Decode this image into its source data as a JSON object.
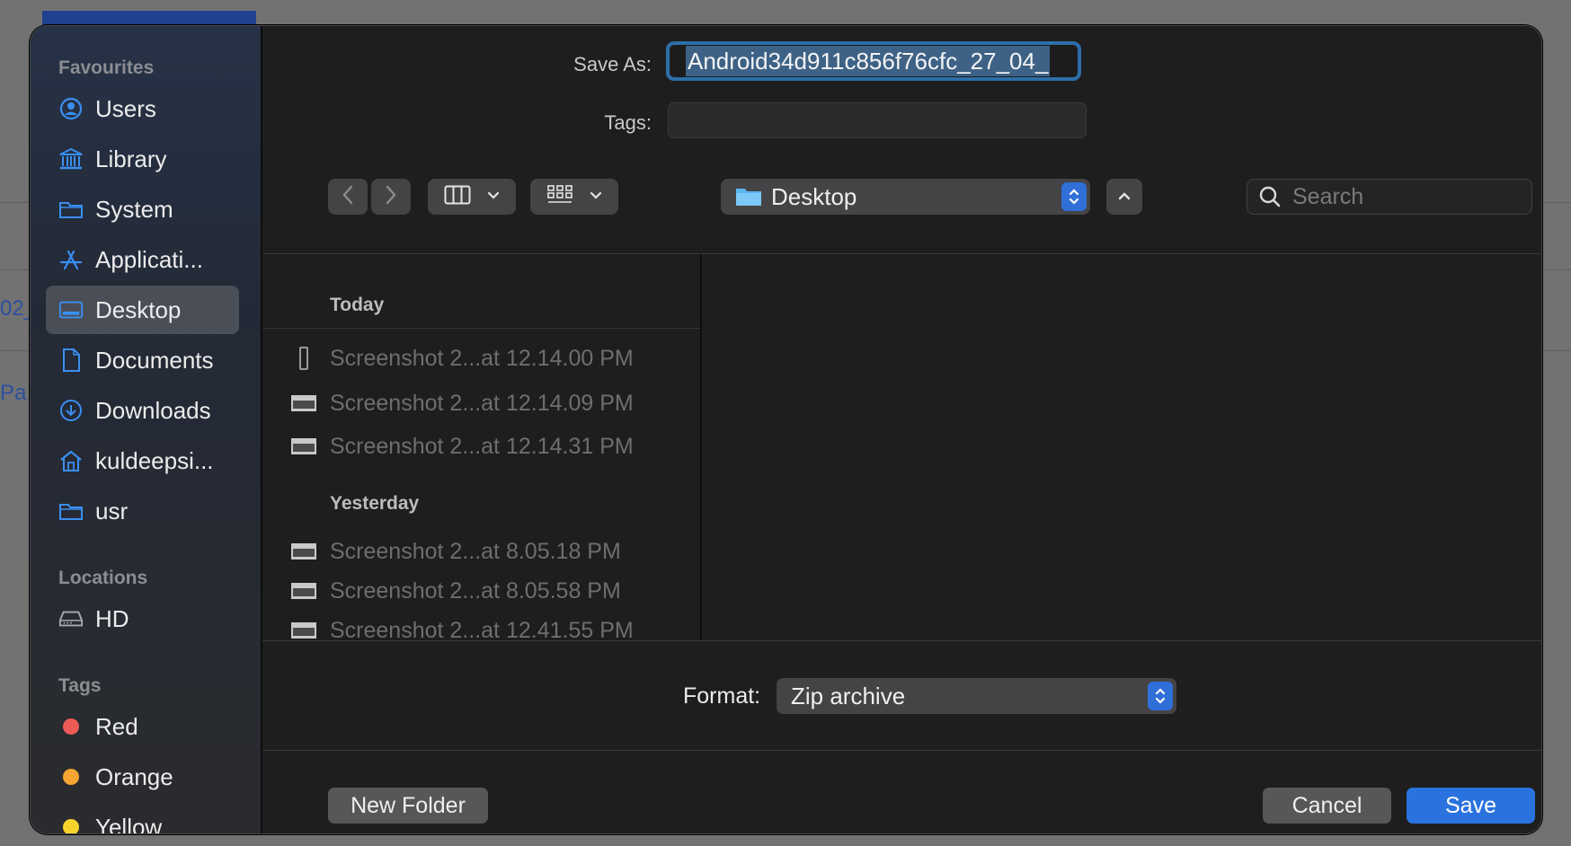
{
  "background": {
    "fragments": [
      "02_",
      "Pa"
    ]
  },
  "sidebar": {
    "favourites_header": "Favourites",
    "favourites": [
      {
        "label": "Users",
        "icon": "user-circle-icon"
      },
      {
        "label": "Library",
        "icon": "library-icon"
      },
      {
        "label": "System",
        "icon": "folder-icon"
      },
      {
        "label": "Applicati...",
        "icon": "applications-icon"
      },
      {
        "label": "Desktop",
        "icon": "desktop-icon",
        "selected": true
      },
      {
        "label": "Documents",
        "icon": "document-icon"
      },
      {
        "label": "Downloads",
        "icon": "download-icon"
      },
      {
        "label": "kuldeepsi...",
        "icon": "home-icon"
      },
      {
        "label": "usr",
        "icon": "folder-icon"
      }
    ],
    "locations_header": "Locations",
    "locations": [
      {
        "label": "HD",
        "icon": "disk-icon"
      }
    ],
    "tags_header": "Tags",
    "tags": [
      {
        "label": "Red",
        "color": "#ec5b56"
      },
      {
        "label": "Orange",
        "color": "#f5a531"
      },
      {
        "label": "Yellow",
        "color": "#f7d42c"
      }
    ]
  },
  "form": {
    "save_as_label": "Save As:",
    "save_as_value": "Android34d911c856f76cfc_27_04_",
    "tags_label": "Tags:",
    "tags_value": ""
  },
  "toolbar": {
    "location": "Desktop",
    "search_placeholder": "Search"
  },
  "browser": {
    "groups": [
      {
        "title": "Today",
        "files": [
          "Screenshot 2...at 12.14.00 PM",
          "Screenshot 2...at 12.14.09 PM",
          "Screenshot 2...at 12.14.31 PM"
        ]
      },
      {
        "title": "Yesterday",
        "files": [
          "Screenshot 2...at 8.05.18 PM",
          "Screenshot 2...at 8.05.58 PM",
          "Screenshot 2...at 12.41.55 PM"
        ]
      }
    ]
  },
  "format": {
    "label": "Format:",
    "value": "Zip archive"
  },
  "buttons": {
    "new_folder": "New Folder",
    "cancel": "Cancel",
    "save": "Save"
  },
  "colors": {
    "accent": "#2a72de",
    "focus_ring": "#2c6ea8"
  }
}
